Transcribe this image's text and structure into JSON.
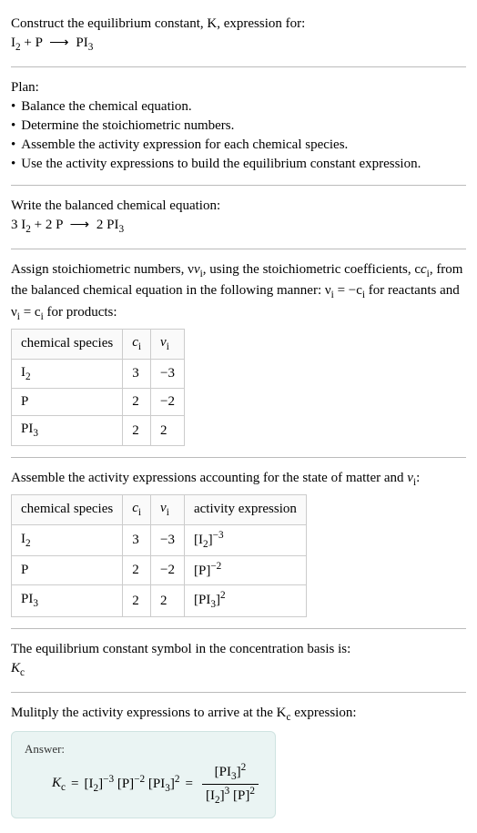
{
  "header": {
    "line1": "Construct the equilibrium constant, K, expression for:",
    "equation_raw": "I₂ + P ⟶ PI₃"
  },
  "plan": {
    "title": "Plan:",
    "items": [
      "Balance the chemical equation.",
      "Determine the stoichiometric numbers.",
      "Assemble the activity expression for each chemical species.",
      "Use the activity expressions to build the equilibrium constant expression."
    ]
  },
  "balanced": {
    "intro": "Write the balanced chemical equation:",
    "equation_raw": "3 I₂ + 2 P ⟶ 2 PI₃"
  },
  "stoich": {
    "intro_part1": "Assign stoichiometric numbers, ν",
    "intro_sub1": "i",
    "intro_part2": ", using the stoichiometric coefficients, c",
    "intro_sub2": "i",
    "intro_part3": ", from the balanced chemical equation in the following manner: ν",
    "intro_sub3": "i",
    "intro_part4": " = −c",
    "intro_sub4": "i",
    "intro_part5": " for reactants and ν",
    "intro_sub5": "i",
    "intro_part6": " = c",
    "intro_sub6": "i",
    "intro_part7": " for products:",
    "headers": {
      "species": "chemical species",
      "c": "cᵢ",
      "v": "νᵢ"
    },
    "rows": [
      {
        "species": "I₂",
        "c": "3",
        "v": "−3"
      },
      {
        "species": "P",
        "c": "2",
        "v": "−2"
      },
      {
        "species": "PI₃",
        "c": "2",
        "v": "2"
      }
    ]
  },
  "activity": {
    "intro": "Assemble the activity expressions accounting for the state of matter and νᵢ:",
    "headers": {
      "species": "chemical species",
      "c": "cᵢ",
      "v": "νᵢ",
      "expr": "activity expression"
    },
    "rows": [
      {
        "species": "I₂",
        "c": "3",
        "v": "−3",
        "expr": "[I₂]⁻³"
      },
      {
        "species": "P",
        "c": "2",
        "v": "−2",
        "expr": "[P]⁻²"
      },
      {
        "species": "PI₃",
        "c": "2",
        "v": "2",
        "expr": "[PI₃]²"
      }
    ]
  },
  "kc_symbol": {
    "intro": "The equilibrium constant symbol in the concentration basis is:",
    "symbol": "K",
    "sub": "c"
  },
  "multiply": {
    "intro_part1": "Mulitply the activity expressions to arrive at the K",
    "intro_sub": "c",
    "intro_part2": " expression:"
  },
  "answer": {
    "label": "Answer:",
    "lhs": "K",
    "lhs_sub": "c",
    "eq": " = ",
    "flat": "[I₂]⁻³ [P]⁻² [PI₃]²",
    "eq2": " = ",
    "frac_num": "[PI₃]²",
    "frac_den": "[I₂]³ [P]²"
  },
  "chart_data": {
    "type": "table",
    "tables": [
      {
        "title": "stoichiometric numbers",
        "columns": [
          "chemical species",
          "cᵢ",
          "νᵢ"
        ],
        "rows": [
          [
            "I₂",
            3,
            -3
          ],
          [
            "P",
            2,
            -2
          ],
          [
            "PI₃",
            2,
            2
          ]
        ]
      },
      {
        "title": "activity expressions",
        "columns": [
          "chemical species",
          "cᵢ",
          "νᵢ",
          "activity expression"
        ],
        "rows": [
          [
            "I₂",
            3,
            -3,
            "[I₂]⁻³"
          ],
          [
            "P",
            2,
            -2,
            "[P]⁻²"
          ],
          [
            "PI₃",
            2,
            2,
            "[PI₃]²"
          ]
        ]
      }
    ]
  }
}
